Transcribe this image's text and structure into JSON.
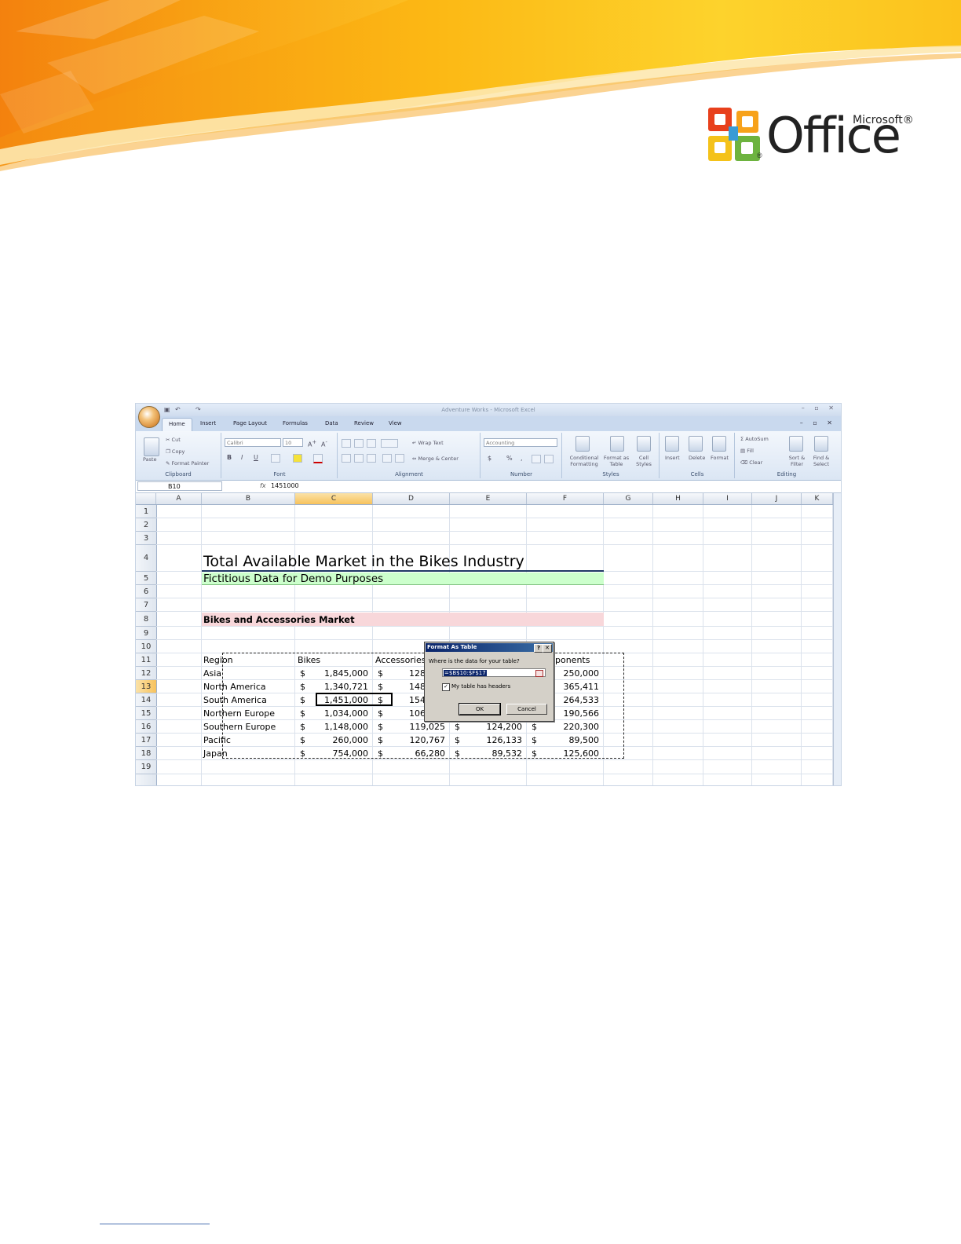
{
  "logo": {
    "microsoft": "Microsoft®",
    "office": "Office",
    "registered": "®"
  },
  "excel": {
    "window_title": "Adventure Works - Microsoft Excel",
    "tabs": [
      {
        "label": "Home",
        "active": true
      },
      {
        "label": "Insert"
      },
      {
        "label": "Page Layout"
      },
      {
        "label": "Formulas"
      },
      {
        "label": "Data"
      },
      {
        "label": "Review"
      },
      {
        "label": "View"
      }
    ],
    "ribbon": {
      "clipboard": {
        "label": "Clipboard",
        "paste": "Paste",
        "cut": "Cut",
        "copy": "Copy",
        "format_painter": "Format Painter"
      },
      "font": {
        "label": "Font",
        "name": "Calibri",
        "size": "10",
        "bold": "B",
        "italic": "I",
        "underline": "U"
      },
      "alignment": {
        "label": "Alignment",
        "wrap_text": "Wrap Text",
        "merge_center": "Merge & Center"
      },
      "number": {
        "label": "Number",
        "format": "Accounting",
        "currency": "$",
        "percent": "%",
        "comma": ","
      },
      "styles": {
        "label": "Styles",
        "conditional": "Conditional Formatting",
        "format_table": "Format as Table",
        "cell_styles": "Cell Styles"
      },
      "cells": {
        "label": "Cells",
        "insert": "Insert",
        "delete": "Delete",
        "format": "Format"
      },
      "editing": {
        "label": "Editing",
        "autosum": "AutoSum",
        "fill": "Fill",
        "clear": "Clear",
        "sort_filter": "Sort & Filter",
        "find_select": "Find & Select"
      }
    },
    "name_box": "B10",
    "fx": "fx",
    "formula": "1451000",
    "columns": [
      "A",
      "B",
      "C",
      "D",
      "E",
      "F",
      "G",
      "H",
      "I",
      "J",
      "K"
    ],
    "selected_column": "C",
    "rows": [
      "1",
      "2",
      "3",
      "4",
      "5",
      "6",
      "7",
      "8",
      "9",
      "10",
      "11",
      "12",
      "13",
      "14",
      "15",
      "16",
      "17",
      "18",
      "19"
    ],
    "selected_row": "13",
    "sheet": {
      "title": "Total Available Market in the Bikes Industry",
      "subtitle": "Fictitious Data for Demo Purposes",
      "section": "Bikes and Accessories Market",
      "headers": [
        "Region",
        "Bikes",
        "Accessories",
        "ponents"
      ],
      "currency_symbol": "$",
      "data": [
        {
          "region": "Asia",
          "bikes": "1,845,000",
          "acc": "128",
          "comp": "250,000",
          "show_e": false
        },
        {
          "region": "North America",
          "bikes": "1,340,721",
          "acc": "148",
          "comp": "365,411",
          "show_e": false
        },
        {
          "region": "South America",
          "bikes": "1,451,000",
          "acc": "154",
          "comp": "264,533",
          "show_e": false
        },
        {
          "region": "Northern Europe",
          "bikes": "1,034,000",
          "acc": "106",
          "comp": "190,566",
          "show_e": false
        },
        {
          "region": "Southern Europe",
          "bikes": "1,148,000",
          "acc": "119,025",
          "e": "124,200",
          "comp": "220,300",
          "show_e": true
        },
        {
          "region": "Pacific",
          "bikes": "260,000",
          "acc": "120,767",
          "e": "126,133",
          "comp": "89,500",
          "show_e": true
        },
        {
          "region": "Japan",
          "bikes": "754,000",
          "acc": "66,280",
          "e": "89,532",
          "comp": "125,600",
          "show_e": true
        }
      ],
      "colors": {
        "title_border": "#1f3864",
        "subtitle_fill": "#ccffcc",
        "section_fill": "#f8d7da"
      }
    },
    "dialog": {
      "title": "Format As Table",
      "help": "?",
      "close": "✕",
      "question": "Where is the data for your table?",
      "range": "=$B$10:$F$17",
      "headers_checkbox": "My table has headers",
      "headers_checked": true,
      "ok": "OK",
      "cancel": "Cancel"
    }
  }
}
